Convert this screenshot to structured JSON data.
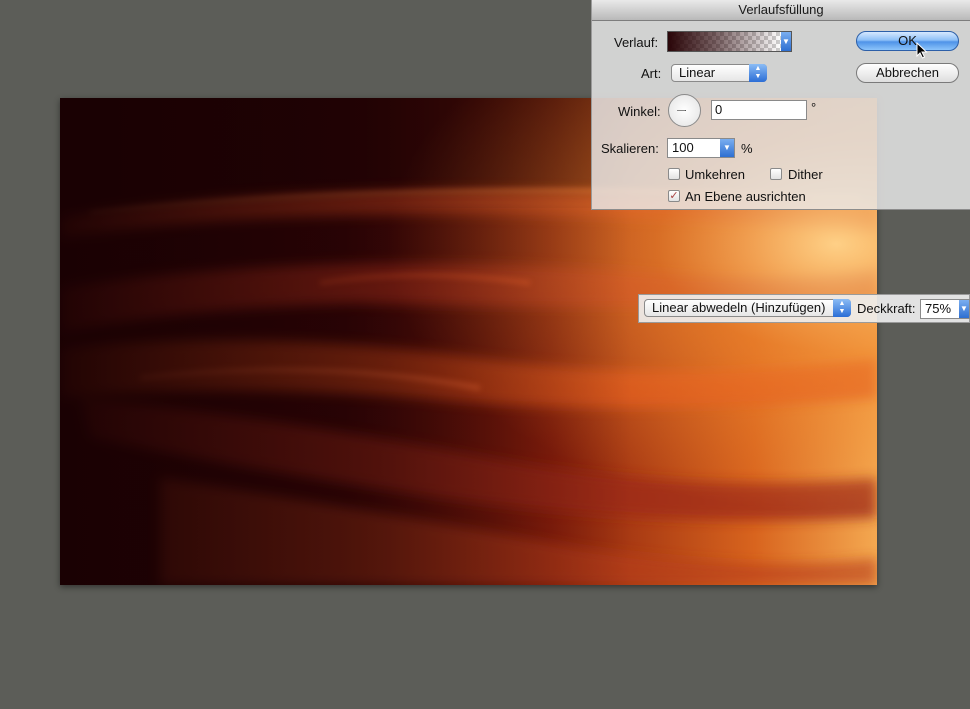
{
  "dialog": {
    "title": "Verlaufsfüllung",
    "gradient_label": "Verlauf:",
    "style_label": "Art:",
    "style_value": "Linear",
    "angle_label": "Winkel:",
    "angle_value": "0",
    "angle_unit": "°",
    "scale_label": "Skalieren:",
    "scale_value": "100",
    "scale_unit": "%",
    "reverse_label": "Umkehren",
    "dither_label": "Dither",
    "align_label": "An Ebene ausrichten",
    "reverse_checked": false,
    "dither_checked": false,
    "align_checked": true,
    "ok_label": "OK",
    "cancel_label": "Abbrechen"
  },
  "layer_options": {
    "blend_mode": "Linear abwedeln (Hinzufügen)",
    "opacity_label": "Deckkraft:",
    "opacity_value": "75%"
  },
  "icons": {
    "cursor": "arrow-cursor-icon",
    "stepper": "up-down-arrows-icon",
    "dropdown": "triangle-down-icon"
  },
  "colors": {
    "workspace": "#5c5d58",
    "accent_blue": "#4f93e8",
    "image_dark": "#2a0508",
    "image_orange": "#f0a24a"
  }
}
